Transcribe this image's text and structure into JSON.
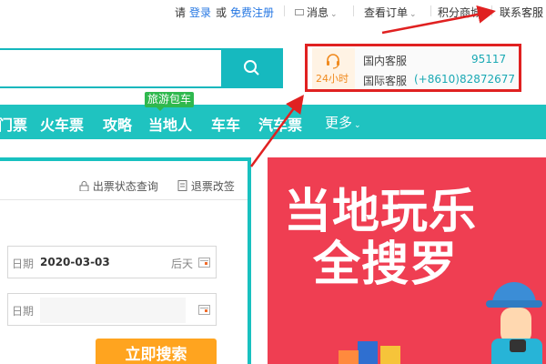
{
  "topbar": {
    "greeting": "请",
    "login": "登录",
    "or": "或",
    "register": "免费注册",
    "messages": "消息",
    "orders": "查看订单",
    "points_mall": "积分商城",
    "contact_service": "联系客服"
  },
  "search": {
    "placeholder": "",
    "button_icon": "search-icon"
  },
  "customer_service": {
    "hours": "24小时",
    "domestic_label": "国内客服",
    "domestic_number": "95117",
    "intl_label": "国际客服",
    "intl_number": "(+8610)82872677",
    "icon": "headset-icon"
  },
  "nav": {
    "tag": "旅游包车",
    "items": [
      "门票",
      "火车票",
      "攻略",
      "当地人",
      "车车",
      "汽车票"
    ],
    "more": "更多"
  },
  "booking_panel": {
    "ticket_status": "出票状态查询",
    "refund_change": "退票改签",
    "date_label": "日期",
    "date_value": "2020-03-03",
    "date_hint": "后天",
    "date2_label": "日期",
    "search_button": "立即搜索"
  },
  "promo": {
    "line1": "当地玩乐",
    "line2": "全搜罗"
  },
  "colors": {
    "accent": "#1fc3c0",
    "highlight": "#e02121",
    "orange": "#ffa41f",
    "promo_bg": "#ef3e52"
  }
}
